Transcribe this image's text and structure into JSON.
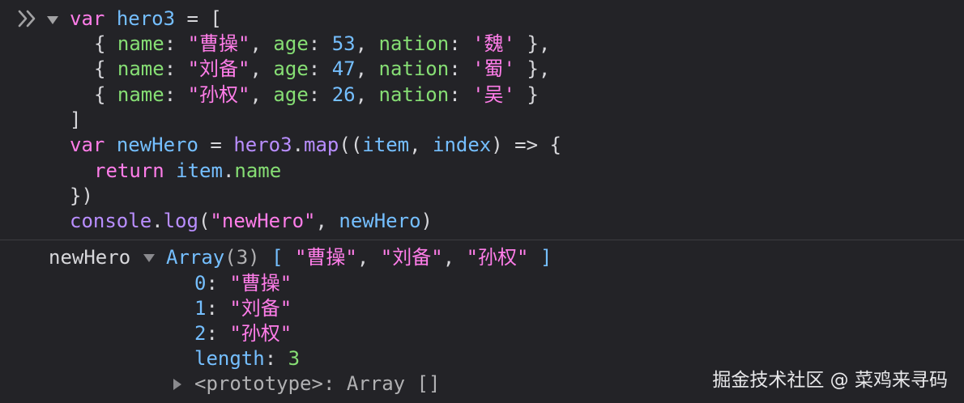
{
  "console": {
    "input": {
      "line1": {
        "kw": "var",
        "name": "hero3",
        "op": " = ["
      },
      "rows": [
        {
          "open": "{ ",
          "k1": "name",
          "c1": ": ",
          "v1": "\"曹操\"",
          "s1": ", ",
          "k2": "age",
          "c2": ": ",
          "v2": "53",
          "s2": ", ",
          "k3": "nation",
          "c3": ": ",
          "v3": "'魏'",
          "close": " },"
        },
        {
          "open": "{ ",
          "k1": "name",
          "c1": ": ",
          "v1": "\"刘备\"",
          "s1": ", ",
          "k2": "age",
          "c2": ": ",
          "v2": "47",
          "s2": ", ",
          "k3": "nation",
          "c3": ": ",
          "v3": "'蜀'",
          "close": " },"
        },
        {
          "open": "{ ",
          "k1": "name",
          "c1": ": ",
          "v1": "\"孙权\"",
          "s1": ", ",
          "k2": "age",
          "c2": ": ",
          "v2": "26",
          "s2": ", ",
          "k3": "nation",
          "c3": ": ",
          "v3": "'吴'",
          "close": " }"
        }
      ],
      "close_bracket": "]",
      "line6": {
        "kw": "var",
        "name": "newHero",
        "eq": " = ",
        "obj": "hero3",
        "dot": ".",
        "method": "map",
        "open": "((",
        "p1": "item",
        "comma": ", ",
        "p2": "index",
        "arrow": ") => {"
      },
      "line7": {
        "kw": "return",
        "obj": "item",
        "dot": ".",
        "prop": "name"
      },
      "line8": "})",
      "line9": {
        "obj": "console",
        "dot": ".",
        "method": "log",
        "open": "(",
        "str": "\"newHero\"",
        "comma": ", ",
        "arg": "newHero",
        "close": ")"
      }
    },
    "output": {
      "label": "newHero",
      "array_type": "Array",
      "array_count": "(3)",
      "preview_open": "[ ",
      "preview_items": [
        "\"曹操\"",
        "\"刘备\"",
        "\"孙权\""
      ],
      "preview_sep": ", ",
      "preview_close": " ]",
      "entries": [
        {
          "key": "0",
          "value": "\"曹操\""
        },
        {
          "key": "1",
          "value": "\"刘备\""
        },
        {
          "key": "2",
          "value": "\"孙权\""
        }
      ],
      "length_key": "length",
      "length_value": "3",
      "prototype_label": "<prototype>",
      "prototype_value": "Array []"
    }
  },
  "watermark": "掘金技术社区 @ 菜鸡来寻码",
  "colors": {
    "background": "#232327",
    "keyword": "#ff7de9",
    "function": "#b98eff",
    "property": "#86de74",
    "number": "#75bfff",
    "string": "#ff7de9",
    "text": "#d7d7db"
  },
  "icons": {
    "prompt": "double-chevron-right-icon",
    "expand": "triangle-down-icon",
    "collapsed": "triangle-right-icon"
  }
}
